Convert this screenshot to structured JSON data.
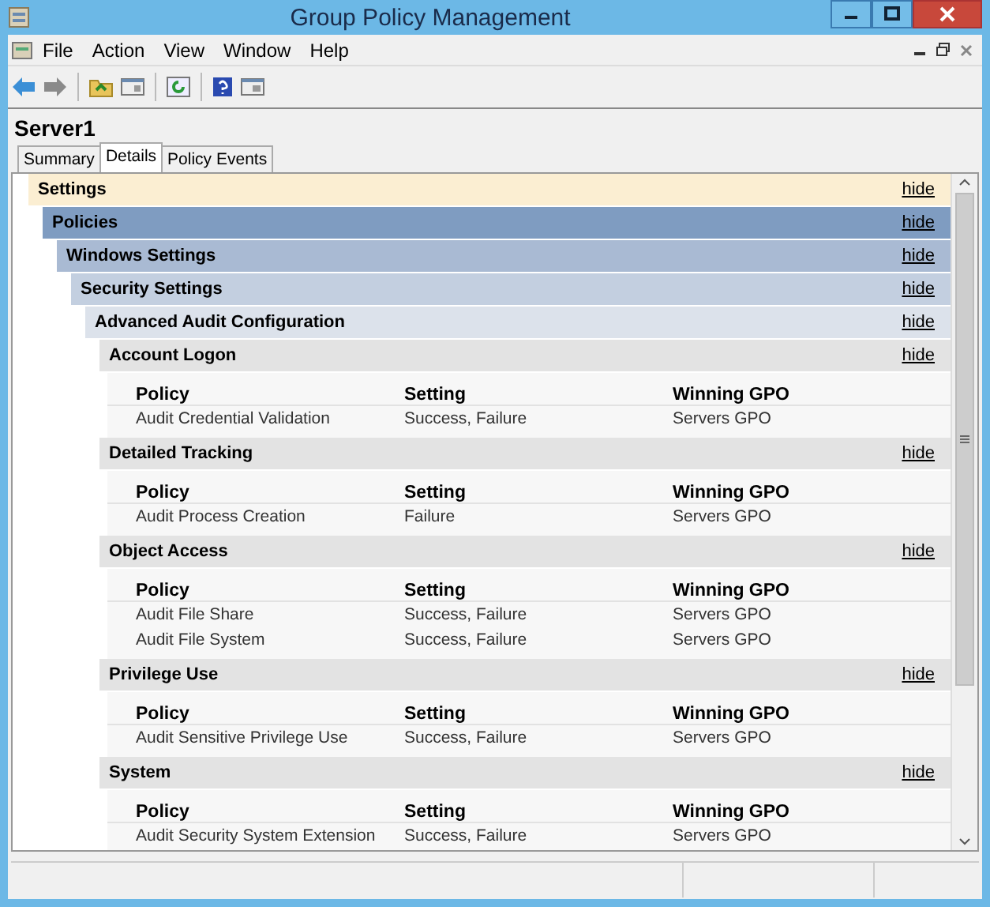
{
  "window": {
    "title": "Group Policy Management"
  },
  "menu": [
    "File",
    "Action",
    "View",
    "Window",
    "Help"
  ],
  "header": {
    "title": "Server1"
  },
  "tabs": [
    {
      "label": "Summary",
      "selected": false
    },
    {
      "label": "Details",
      "selected": true
    },
    {
      "label": "Policy Events",
      "selected": false
    }
  ],
  "report": {
    "title": "Settings",
    "link": "hide",
    "children": [
      {
        "title": "Policies",
        "link": "hide",
        "children": [
          {
            "title": "Windows Settings",
            "link": "hide",
            "children": [
              {
                "title": "Security Settings",
                "link": "hide",
                "children": [
                  {
                    "title": "Advanced Audit Configuration",
                    "link": "hide",
                    "children": [
                      {
                        "title": "Account Logon",
                        "link": "hide",
                        "table": {
                          "columns": [
                            "Policy",
                            "Setting",
                            "Winning GPO"
                          ],
                          "rows": [
                            [
                              "Audit Credential Validation",
                              "Success, Failure",
                              "Servers GPO"
                            ]
                          ]
                        }
                      },
                      {
                        "title": "Detailed Tracking",
                        "link": "hide",
                        "table": {
                          "columns": [
                            "Policy",
                            "Setting",
                            "Winning GPO"
                          ],
                          "rows": [
                            [
                              "Audit Process Creation",
                              "Failure",
                              "Servers GPO"
                            ]
                          ]
                        }
                      },
                      {
                        "title": "Object Access",
                        "link": "hide",
                        "table": {
                          "columns": [
                            "Policy",
                            "Setting",
                            "Winning GPO"
                          ],
                          "rows": [
                            [
                              "Audit File Share",
                              "Success, Failure",
                              "Servers GPO"
                            ],
                            [
                              "Audit File System",
                              "Success, Failure",
                              "Servers GPO"
                            ]
                          ]
                        }
                      },
                      {
                        "title": "Privilege Use",
                        "link": "hide",
                        "table": {
                          "columns": [
                            "Policy",
                            "Setting",
                            "Winning GPO"
                          ],
                          "rows": [
                            [
                              "Audit Sensitive Privilege Use",
                              "Success, Failure",
                              "Servers GPO"
                            ]
                          ]
                        }
                      },
                      {
                        "title": "System",
                        "link": "hide",
                        "table": {
                          "columns": [
                            "Policy",
                            "Setting",
                            "Winning GPO"
                          ],
                          "rows": [
                            [
                              "Audit Security System Extension",
                              "Success, Failure",
                              "Servers GPO"
                            ]
                          ]
                        }
                      }
                    ]
                  }
                ]
              }
            ]
          }
        ]
      }
    ]
  }
}
